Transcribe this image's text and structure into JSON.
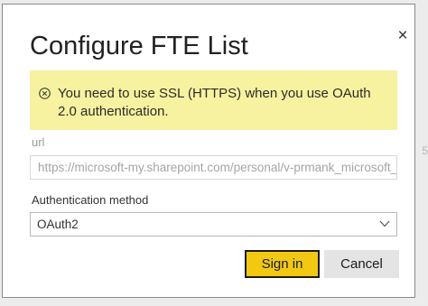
{
  "dialog": {
    "title": "Configure FTE List",
    "close_glyph": "×"
  },
  "banner": {
    "icon": "circle-x-icon",
    "message": "You need to use SSL (HTTPS) when you use OAuth 2.0 authentication.",
    "background_color": "#f6f29f"
  },
  "url_field": {
    "label": "url",
    "value": "https://microsoft-my.sharepoint.com/personal/v-prmank_microsoft_"
  },
  "auth_field": {
    "label": "Authentication method",
    "selected": "OAuth2",
    "dropdown_icon": "chevron-down-icon"
  },
  "buttons": {
    "sign_in": "Sign in",
    "cancel": "Cancel",
    "sign_in_color": "#f2c811"
  }
}
